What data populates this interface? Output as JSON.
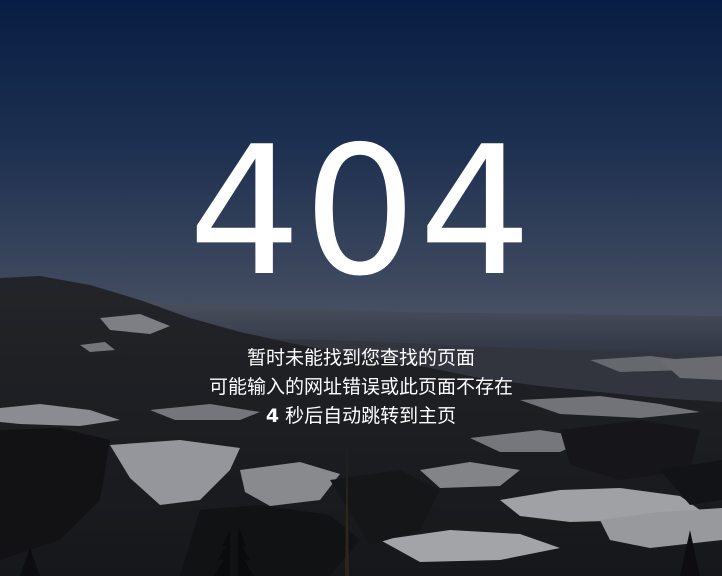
{
  "error_page": {
    "code": "404",
    "message_line1": "暂时未能找到您查找的页面",
    "message_line2": "可能输入的网址错误或此页面不存在",
    "countdown_seconds": "4",
    "countdown_suffix": " 秒后自动跳转到主页"
  },
  "background": {
    "sky_top_color": "#0b2552",
    "sky_bottom_color": "#6c7488",
    "description_icon": "mountain-landscape-image"
  }
}
